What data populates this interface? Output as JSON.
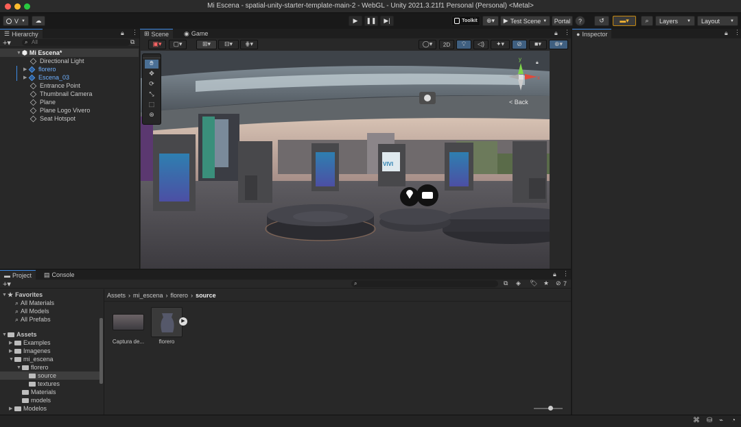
{
  "window": {
    "title": "Mi Escena - spatial-unity-starter-template-main-2 - WebGL - Unity 2021.3.21f1 Personal (Personal) <Metal>"
  },
  "toolbar": {
    "account": "V",
    "toolkit": "Toolkit",
    "test_scene": "Test Scene",
    "portal": "Portal",
    "help": "?",
    "layers": "Layers",
    "layout": "Layout"
  },
  "hierarchy": {
    "tab": "Hierarchy",
    "search_placeholder": "All",
    "scene": "Mi Escena*",
    "items": [
      "Directional Light",
      "florero",
      "Escena_03",
      "Entrance Point",
      "Thumbnail Camera",
      "Plane",
      "Plane Logo Vivero",
      "Seat Hotspot"
    ]
  },
  "scene_view": {
    "tab_scene": "Scene",
    "tab_game": "Game",
    "mode_2d": "2D",
    "back": "< Back",
    "gizmo_y": "y",
    "gizmo_x": "x",
    "sign_text": "VIVI"
  },
  "inspector": {
    "tab": "Inspector"
  },
  "project": {
    "tab_project": "Project",
    "tab_console": "Console",
    "favorites": "Favorites",
    "fav_items": [
      "All Materials",
      "All Models",
      "All Prefabs"
    ],
    "assets": "Assets",
    "tree": [
      "Examples",
      "Imagenes",
      "mi_escena",
      "florero",
      "source",
      "textures",
      "Materials",
      "models",
      "Modelos"
    ],
    "breadcrumb": [
      "Assets",
      "mi_escena",
      "florero",
      "source"
    ],
    "files": [
      "Captura de...",
      "florero"
    ],
    "hidden_count": "7"
  },
  "colors": {
    "accent": "#3d8ce8",
    "selected": "#2c5d87",
    "blue_text": "#6fb0ff"
  }
}
